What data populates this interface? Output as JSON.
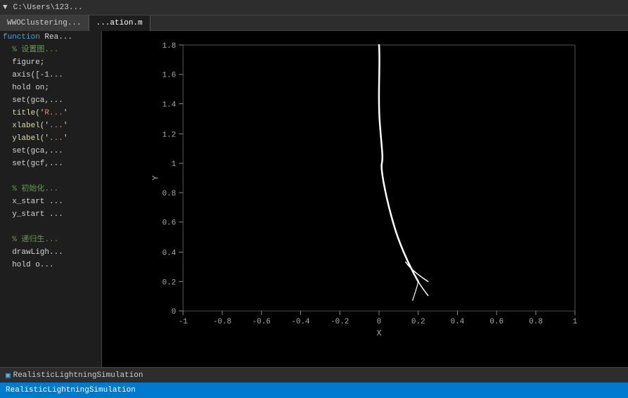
{
  "toolbar": {
    "arrow": "▶",
    "path": "C:\\Users\\123...",
    "menus": [
      "▼"
    ]
  },
  "tabs": [
    {
      "label": "WWOClustering...",
      "active": false
    },
    {
      "label": "...ation.m",
      "active": true
    }
  ],
  "code": [
    {
      "text": "function Rea...",
      "color": "blue"
    },
    {
      "text": "  % 设置图...",
      "color": "comment"
    },
    {
      "text": "  figure;",
      "color": "white"
    },
    {
      "text": "  axis([-1...",
      "color": "white"
    },
    {
      "text": "  hold on;",
      "color": "white"
    },
    {
      "text": "  set(gca,...",
      "color": "white"
    },
    {
      "text": "  title('R...",
      "color": "white"
    },
    {
      "text": "  xlabel('...",
      "color": "white"
    },
    {
      "text": "  ylabel('...",
      "color": "white"
    },
    {
      "text": "  set(gca,...",
      "color": "white"
    },
    {
      "text": "  set(gcf,...",
      "color": "white"
    },
    {
      "text": "",
      "color": "white"
    },
    {
      "text": "  % 初始化...",
      "color": "comment"
    },
    {
      "text": "  x_start ...",
      "color": "white"
    },
    {
      "text": "  y_start ...",
      "color": "white"
    },
    {
      "text": "",
      "color": "white"
    },
    {
      "text": "  % 递归生...",
      "color": "comment"
    },
    {
      "text": "  drawLigh...",
      "color": "white"
    },
    {
      "text": "  hold o...",
      "color": "white"
    }
  ],
  "function_label": "function",
  "chart": {
    "title": "",
    "x_label": "X",
    "y_label": "Y",
    "x_ticks": [
      "-1",
      "-0.8",
      "-0.6",
      "-0.4",
      "-0.2",
      "0",
      "0.2",
      "0.4",
      "0.6",
      "0.8",
      "1"
    ],
    "y_ticks": [
      "0",
      "0.2",
      "0.4",
      "0.6",
      "0.8",
      "1",
      "1.2",
      "1.4",
      "1.6",
      "1.8"
    ]
  },
  "status": {
    "bottom_text": "RealisticLightningSimulation",
    "function_text": "function"
  }
}
